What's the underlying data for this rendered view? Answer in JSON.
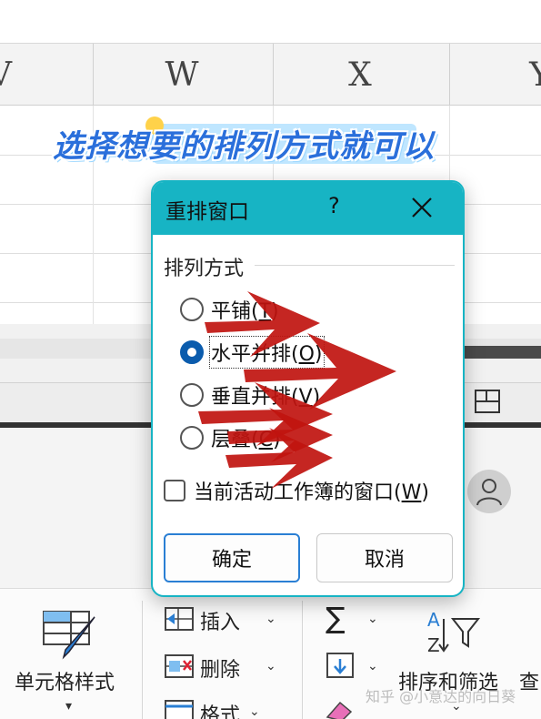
{
  "spreadsheet": {
    "columns": [
      "V",
      "W",
      "X",
      "Y"
    ],
    "banner_text": "选择想要的排列方式就可以"
  },
  "dialog": {
    "title": "重排窗口",
    "help_label": "?",
    "group_label": "排列方式",
    "options": [
      {
        "label": "平铺(",
        "hotkey": "T",
        "suffix": ")",
        "selected": false
      },
      {
        "label": "水平并排(",
        "hotkey": "O",
        "suffix": ")",
        "selected": true
      },
      {
        "label": "垂直并排(",
        "hotkey": "V",
        "suffix": ")",
        "selected": false
      },
      {
        "label": "层叠(",
        "hotkey": "C",
        "suffix": ")",
        "selected": false
      }
    ],
    "checkbox": {
      "label": "当前活动工作簿的窗口(",
      "hotkey": "W",
      "suffix": ")",
      "checked": false
    },
    "ok_label": "确定",
    "cancel_label": "取消",
    "accent_color": "#17b4c4"
  },
  "ribbon": {
    "cell_style_label": "单元格样式",
    "insert_label": "插入",
    "delete_label": "删除",
    "format_label": "格式",
    "sort_filter_label": "排序和筛选",
    "find_label": "查",
    "icons": [
      "cell-style-icon",
      "insert-icon",
      "delete-icon",
      "format-icon",
      "sum-icon",
      "fill-icon",
      "clear-icon",
      "sort-filter-icon",
      "user-avatar-icon",
      "layout-icon"
    ]
  },
  "watermark": "知乎 @小意达的向日葵",
  "annotation": {
    "arrow_color": "#c0140f",
    "arrow_count": 5
  }
}
